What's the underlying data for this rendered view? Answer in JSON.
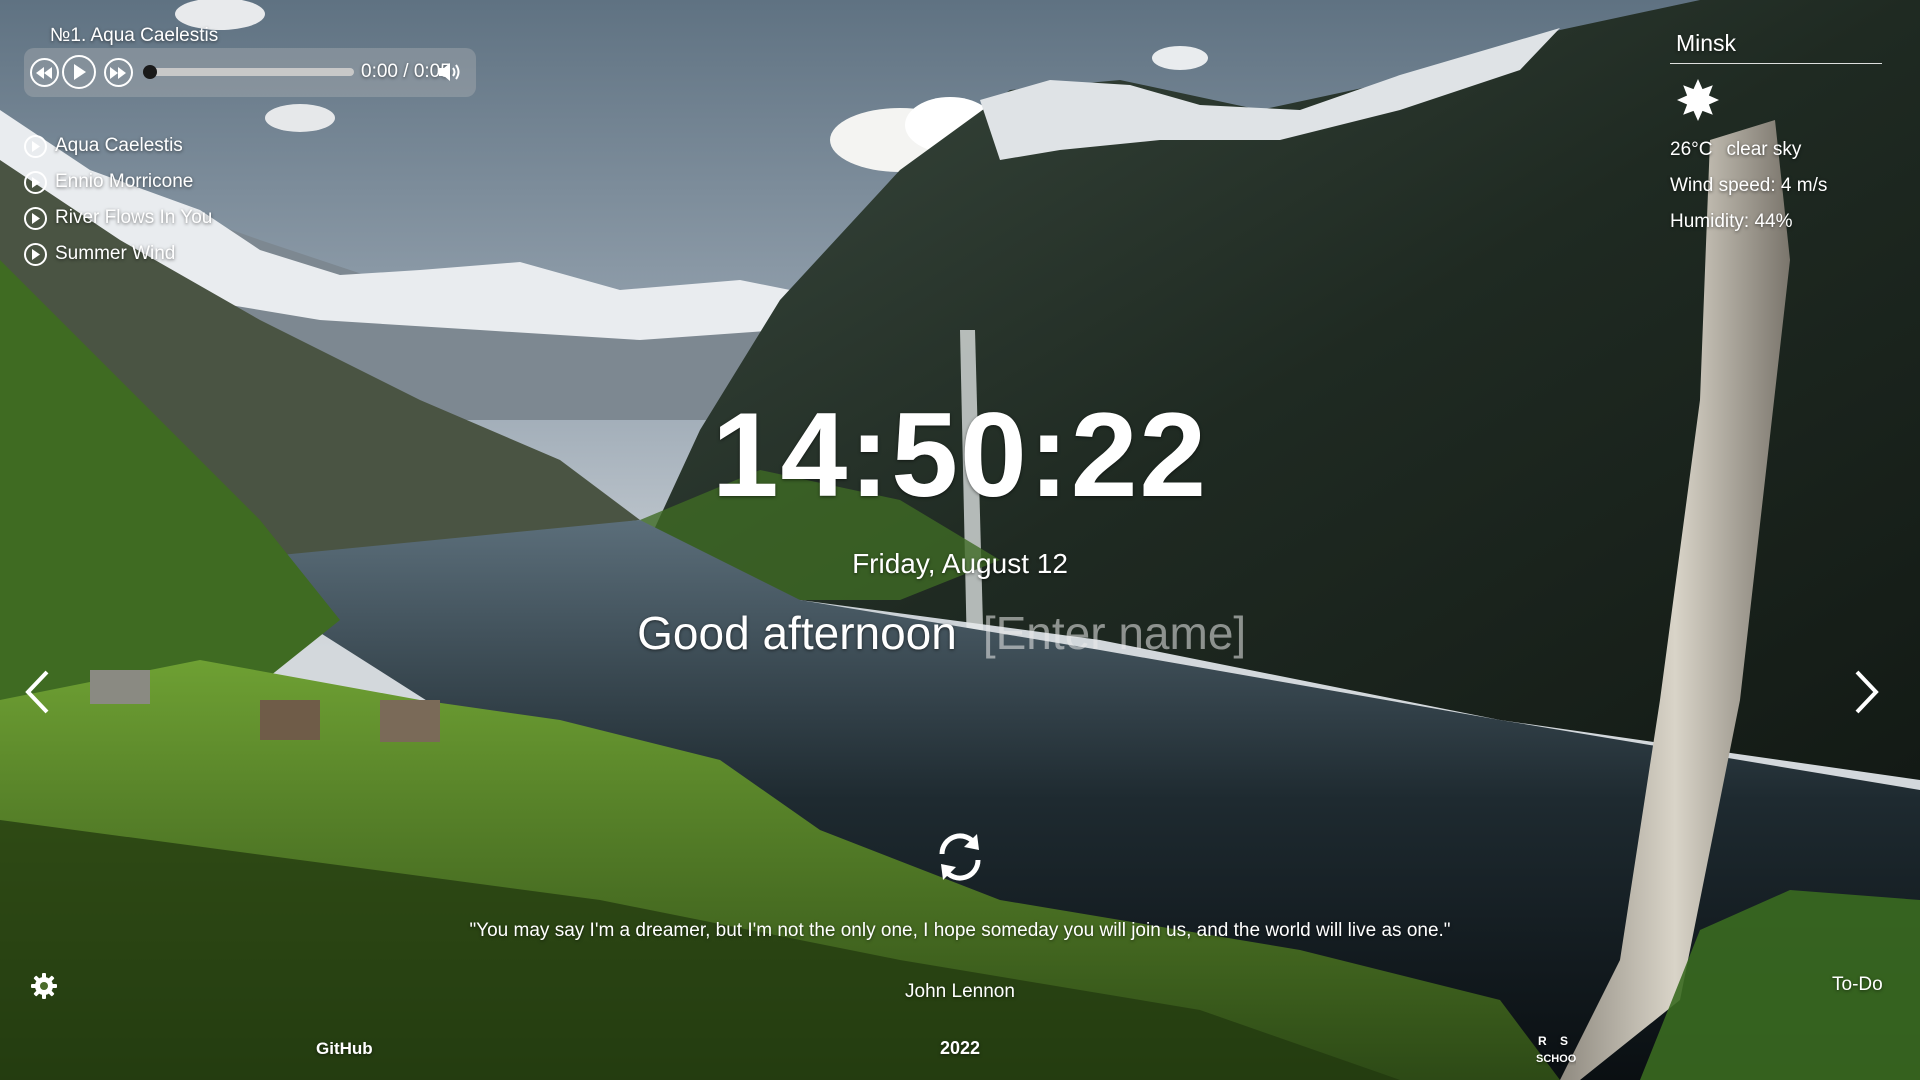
{
  "player": {
    "track_title": "№1. Aqua Caelestis",
    "time": "0:00 / 0:05",
    "progress_fraction": 0.0,
    "playlist": [
      {
        "label": "Aqua Caelestis"
      },
      {
        "label": "Ennio Morricone"
      },
      {
        "label": "River Flows In You"
      },
      {
        "label": "Summer Wind"
      }
    ]
  },
  "weather": {
    "city": "Minsk",
    "icon": "sun-icon",
    "temperature": "26°C",
    "description": "clear sky",
    "wind": "Wind speed: 4 m/s",
    "humidity": "Humidity: 44%"
  },
  "clock": {
    "time": "14:50:22",
    "date": "Friday, August 12"
  },
  "greeting": {
    "text": "Good afternoon",
    "name_placeholder": "[Enter name]"
  },
  "quote": {
    "text": "\"You may say I'm a dreamer, but I'm not the only one, I hope someday you will join us, and the world will live as one.\"",
    "author": "John Lennon"
  },
  "footer": {
    "github": "GitHub",
    "year": "2022",
    "todo": "To-Do",
    "logo_text": [
      "R",
      "S",
      "SCHOOL"
    ]
  },
  "colors": {
    "text": "#ffffff",
    "player_panel": "rgba(190,190,190,0.32)",
    "progress_track": "#c8c8c8"
  }
}
